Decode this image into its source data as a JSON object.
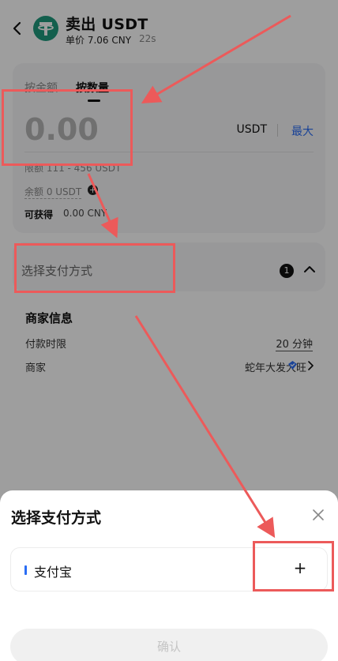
{
  "header": {
    "title": "卖出 USDT",
    "price": "单价 7.06 CNY",
    "timer": "22s"
  },
  "trade_card": {
    "tabs": [
      {
        "label": "按金额",
        "active": false
      },
      {
        "label": "按数量",
        "active": true
      }
    ],
    "amount_placeholder": "0.00",
    "unit": "USDT",
    "max_label": "最大",
    "limit": "限额 111 - 456 USDT",
    "balance": "余额 0 USDT",
    "receive_label": "可获得",
    "receive_value": "0.00 CNY"
  },
  "payment_selector": {
    "label": "选择支付方式",
    "count": "1"
  },
  "merchant": {
    "title": "商家信息",
    "pay_time_label": "付款时限",
    "pay_time_value": "20 分钟",
    "merchant_label": "商家",
    "merchant_name": "蛇年大发大旺"
  },
  "sheet": {
    "title": "选择支付方式",
    "options": [
      {
        "label": "支付宝",
        "action": "+"
      }
    ],
    "confirm_label": "确认"
  },
  "colors": {
    "accent": "#2a6df4",
    "usdt_green": "#1f9a7d",
    "annotation_red": "#ec5a5a"
  }
}
